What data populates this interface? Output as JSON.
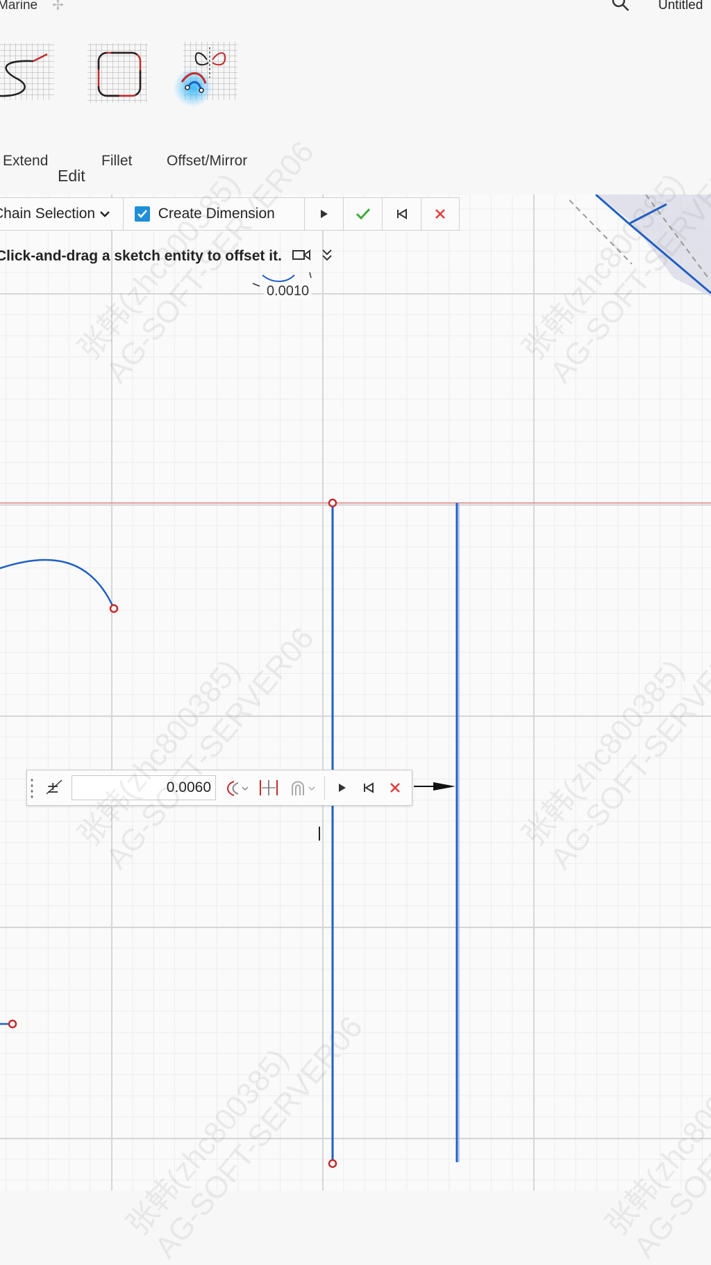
{
  "header": {
    "app_tab": "Marine",
    "doc_title": "Untitled"
  },
  "ribbon": {
    "tools": [
      {
        "label": "Extend",
        "icon": "extend-icon"
      },
      {
        "label": "Fillet",
        "icon": "fillet-icon"
      },
      {
        "label": "Offset/Mirror",
        "icon": "offset-mirror-icon"
      }
    ],
    "group_label": "Edit"
  },
  "command_bar": {
    "chain_selection": "Chain Selection",
    "create_dimension": "Create Dimension",
    "create_dimension_checked": true
  },
  "hint": {
    "text": "Click-and-drag a sketch entity to offset it."
  },
  "sketch": {
    "dimension_readout": "0.0010"
  },
  "offset_dialog": {
    "distance": "0.0060"
  },
  "watermark": {
    "line1": "张韩(zhc800385)",
    "line2": "AG-SOFT-SERVER06"
  },
  "colors": {
    "sketch_line": "#1f5fc4",
    "endpoint": "#c42a2a",
    "axis_line": "#e2a0a0",
    "accept": "#3caa3c",
    "cancel": "#e23b3b",
    "checkbox": "#1e8fd8"
  }
}
